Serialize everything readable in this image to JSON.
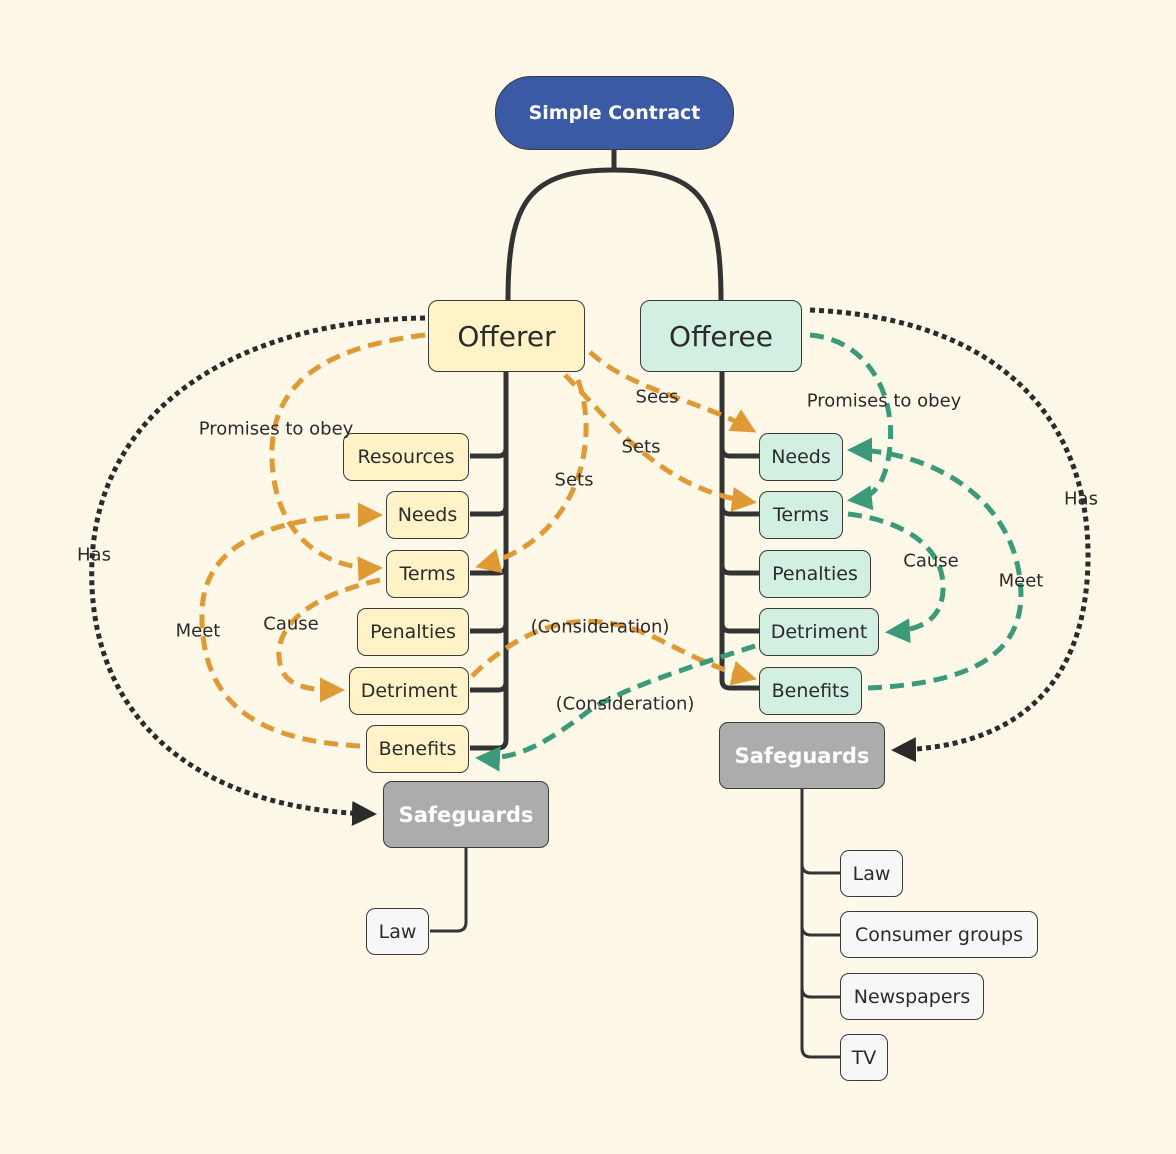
{
  "root": {
    "label": "Simple Contract",
    "color": "#3a5aa5"
  },
  "offerer": {
    "label": "Offerer",
    "color": "#fff3c7",
    "children": [
      "Resources",
      "Needs",
      "Terms",
      "Penalties",
      "Detriment",
      "Benefits"
    ],
    "safeguards": {
      "label": "Safeguards",
      "children": [
        "Law"
      ]
    }
  },
  "offeree": {
    "label": "Offeree",
    "color": "#d2f0e2",
    "children": [
      "Needs",
      "Terms",
      "Penalties",
      "Detriment",
      "Benefits"
    ],
    "safeguards": {
      "label": "Safeguards",
      "children": [
        "Law",
        "Consumer groups",
        "Newspapers",
        "TV"
      ]
    }
  },
  "relations": {
    "offerer_promises": "Promises to obey",
    "offerer_sets_own_terms": "Sets",
    "offerer_sees": "Sees",
    "offerer_sets_offeree_terms": "Sets",
    "offerer_cause": "Cause",
    "offerer_meet": "Meet",
    "offerer_consideration": "(Consideration)",
    "offerer_has": "Has",
    "offeree_promises": "Promises to obey",
    "offeree_cause": "Cause",
    "offeree_meet": "Meet",
    "offeree_consideration": "(Consideration)",
    "offeree_has": "Has"
  },
  "colors": {
    "offerer_arrow": "#e09a35",
    "offeree_arrow": "#3a9a7a",
    "has_arrow": "#2b2b2b",
    "connector": "#333333"
  }
}
